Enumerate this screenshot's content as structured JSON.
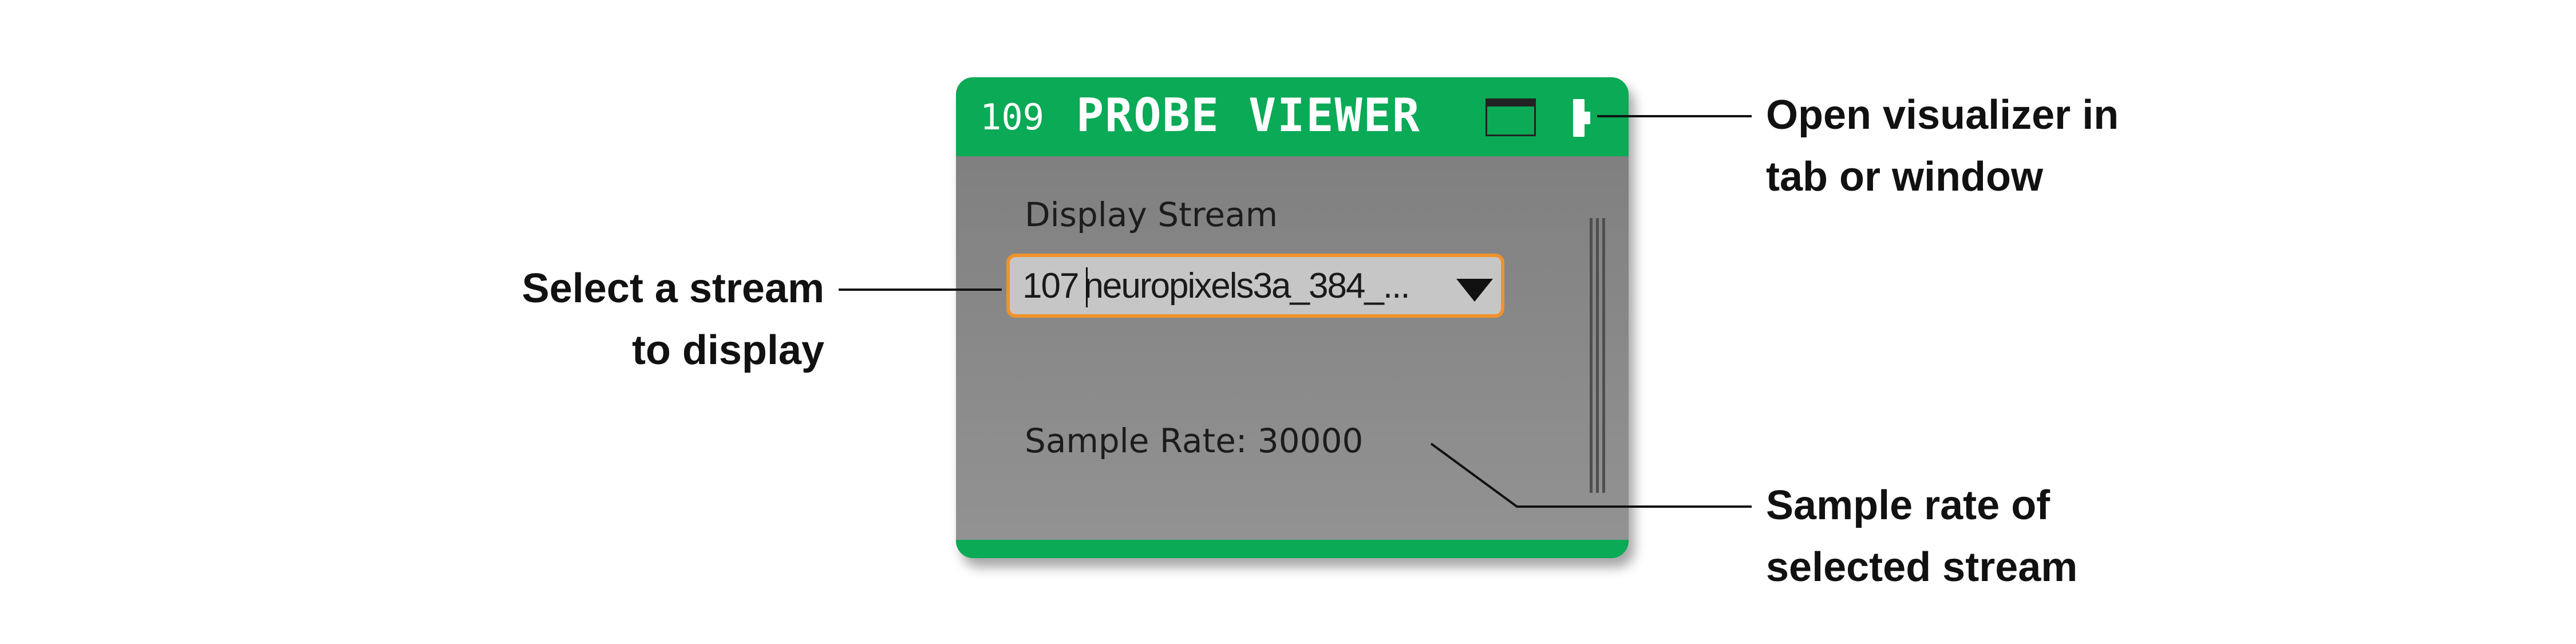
{
  "panel": {
    "node_id": "109",
    "title": "PROBE VIEWER",
    "header_color": "#0aaa56",
    "buttons": {
      "tab_icon": "tab-icon",
      "window_icon": "window-icon"
    },
    "stream_label": "Display Stream",
    "stream_select": {
      "id": "107",
      "name": "neuropixels3a_384_...",
      "highlight_color": "#f0922a",
      "arrow_icon": "dropdown-arrow-icon"
    },
    "sample_rate": "Sample Rate: 30000"
  },
  "annotations": {
    "open_visualizer": {
      "line1": "Open visualizer in",
      "line2": "tab or window"
    },
    "select_stream": {
      "line1": "Select a stream",
      "line2": "to display"
    },
    "sample_rate": {
      "line1": "Sample rate of",
      "line2": "selected stream"
    }
  }
}
